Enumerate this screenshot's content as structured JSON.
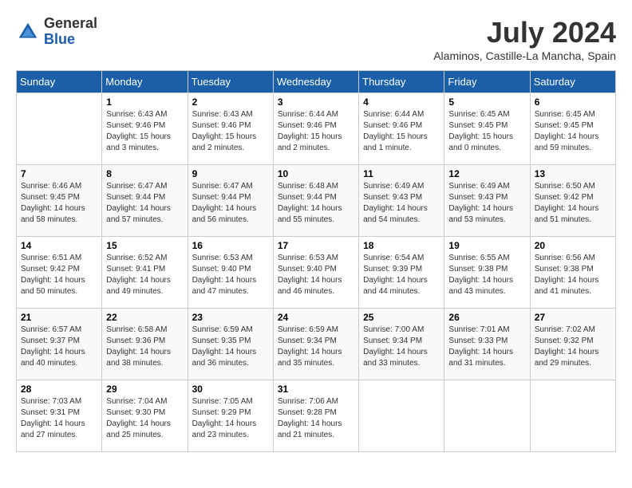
{
  "logo": {
    "general": "General",
    "blue": "Blue"
  },
  "title": {
    "month_year": "July 2024",
    "location": "Alaminos, Castille-La Mancha, Spain"
  },
  "days_of_week": [
    "Sunday",
    "Monday",
    "Tuesday",
    "Wednesday",
    "Thursday",
    "Friday",
    "Saturday"
  ],
  "weeks": [
    [
      {
        "day": "",
        "sunrise": "",
        "sunset": "",
        "daylight": ""
      },
      {
        "day": "1",
        "sunrise": "Sunrise: 6:43 AM",
        "sunset": "Sunset: 9:46 PM",
        "daylight": "Daylight: 15 hours and 3 minutes."
      },
      {
        "day": "2",
        "sunrise": "Sunrise: 6:43 AM",
        "sunset": "Sunset: 9:46 PM",
        "daylight": "Daylight: 15 hours and 2 minutes."
      },
      {
        "day": "3",
        "sunrise": "Sunrise: 6:44 AM",
        "sunset": "Sunset: 9:46 PM",
        "daylight": "Daylight: 15 hours and 2 minutes."
      },
      {
        "day": "4",
        "sunrise": "Sunrise: 6:44 AM",
        "sunset": "Sunset: 9:46 PM",
        "daylight": "Daylight: 15 hours and 1 minute."
      },
      {
        "day": "5",
        "sunrise": "Sunrise: 6:45 AM",
        "sunset": "Sunset: 9:45 PM",
        "daylight": "Daylight: 15 hours and 0 minutes."
      },
      {
        "day": "6",
        "sunrise": "Sunrise: 6:45 AM",
        "sunset": "Sunset: 9:45 PM",
        "daylight": "Daylight: 14 hours and 59 minutes."
      }
    ],
    [
      {
        "day": "7",
        "sunrise": "Sunrise: 6:46 AM",
        "sunset": "Sunset: 9:45 PM",
        "daylight": "Daylight: 14 hours and 58 minutes."
      },
      {
        "day": "8",
        "sunrise": "Sunrise: 6:47 AM",
        "sunset": "Sunset: 9:44 PM",
        "daylight": "Daylight: 14 hours and 57 minutes."
      },
      {
        "day": "9",
        "sunrise": "Sunrise: 6:47 AM",
        "sunset": "Sunset: 9:44 PM",
        "daylight": "Daylight: 14 hours and 56 minutes."
      },
      {
        "day": "10",
        "sunrise": "Sunrise: 6:48 AM",
        "sunset": "Sunset: 9:44 PM",
        "daylight": "Daylight: 14 hours and 55 minutes."
      },
      {
        "day": "11",
        "sunrise": "Sunrise: 6:49 AM",
        "sunset": "Sunset: 9:43 PM",
        "daylight": "Daylight: 14 hours and 54 minutes."
      },
      {
        "day": "12",
        "sunrise": "Sunrise: 6:49 AM",
        "sunset": "Sunset: 9:43 PM",
        "daylight": "Daylight: 14 hours and 53 minutes."
      },
      {
        "day": "13",
        "sunrise": "Sunrise: 6:50 AM",
        "sunset": "Sunset: 9:42 PM",
        "daylight": "Daylight: 14 hours and 51 minutes."
      }
    ],
    [
      {
        "day": "14",
        "sunrise": "Sunrise: 6:51 AM",
        "sunset": "Sunset: 9:42 PM",
        "daylight": "Daylight: 14 hours and 50 minutes."
      },
      {
        "day": "15",
        "sunrise": "Sunrise: 6:52 AM",
        "sunset": "Sunset: 9:41 PM",
        "daylight": "Daylight: 14 hours and 49 minutes."
      },
      {
        "day": "16",
        "sunrise": "Sunrise: 6:53 AM",
        "sunset": "Sunset: 9:40 PM",
        "daylight": "Daylight: 14 hours and 47 minutes."
      },
      {
        "day": "17",
        "sunrise": "Sunrise: 6:53 AM",
        "sunset": "Sunset: 9:40 PM",
        "daylight": "Daylight: 14 hours and 46 minutes."
      },
      {
        "day": "18",
        "sunrise": "Sunrise: 6:54 AM",
        "sunset": "Sunset: 9:39 PM",
        "daylight": "Daylight: 14 hours and 44 minutes."
      },
      {
        "day": "19",
        "sunrise": "Sunrise: 6:55 AM",
        "sunset": "Sunset: 9:38 PM",
        "daylight": "Daylight: 14 hours and 43 minutes."
      },
      {
        "day": "20",
        "sunrise": "Sunrise: 6:56 AM",
        "sunset": "Sunset: 9:38 PM",
        "daylight": "Daylight: 14 hours and 41 minutes."
      }
    ],
    [
      {
        "day": "21",
        "sunrise": "Sunrise: 6:57 AM",
        "sunset": "Sunset: 9:37 PM",
        "daylight": "Daylight: 14 hours and 40 minutes."
      },
      {
        "day": "22",
        "sunrise": "Sunrise: 6:58 AM",
        "sunset": "Sunset: 9:36 PM",
        "daylight": "Daylight: 14 hours and 38 minutes."
      },
      {
        "day": "23",
        "sunrise": "Sunrise: 6:59 AM",
        "sunset": "Sunset: 9:35 PM",
        "daylight": "Daylight: 14 hours and 36 minutes."
      },
      {
        "day": "24",
        "sunrise": "Sunrise: 6:59 AM",
        "sunset": "Sunset: 9:34 PM",
        "daylight": "Daylight: 14 hours and 35 minutes."
      },
      {
        "day": "25",
        "sunrise": "Sunrise: 7:00 AM",
        "sunset": "Sunset: 9:34 PM",
        "daylight": "Daylight: 14 hours and 33 minutes."
      },
      {
        "day": "26",
        "sunrise": "Sunrise: 7:01 AM",
        "sunset": "Sunset: 9:33 PM",
        "daylight": "Daylight: 14 hours and 31 minutes."
      },
      {
        "day": "27",
        "sunrise": "Sunrise: 7:02 AM",
        "sunset": "Sunset: 9:32 PM",
        "daylight": "Daylight: 14 hours and 29 minutes."
      }
    ],
    [
      {
        "day": "28",
        "sunrise": "Sunrise: 7:03 AM",
        "sunset": "Sunset: 9:31 PM",
        "daylight": "Daylight: 14 hours and 27 minutes."
      },
      {
        "day": "29",
        "sunrise": "Sunrise: 7:04 AM",
        "sunset": "Sunset: 9:30 PM",
        "daylight": "Daylight: 14 hours and 25 minutes."
      },
      {
        "day": "30",
        "sunrise": "Sunrise: 7:05 AM",
        "sunset": "Sunset: 9:29 PM",
        "daylight": "Daylight: 14 hours and 23 minutes."
      },
      {
        "day": "31",
        "sunrise": "Sunrise: 7:06 AM",
        "sunset": "Sunset: 9:28 PM",
        "daylight": "Daylight: 14 hours and 21 minutes."
      },
      {
        "day": "",
        "sunrise": "",
        "sunset": "",
        "daylight": ""
      },
      {
        "day": "",
        "sunrise": "",
        "sunset": "",
        "daylight": ""
      },
      {
        "day": "",
        "sunrise": "",
        "sunset": "",
        "daylight": ""
      }
    ]
  ]
}
